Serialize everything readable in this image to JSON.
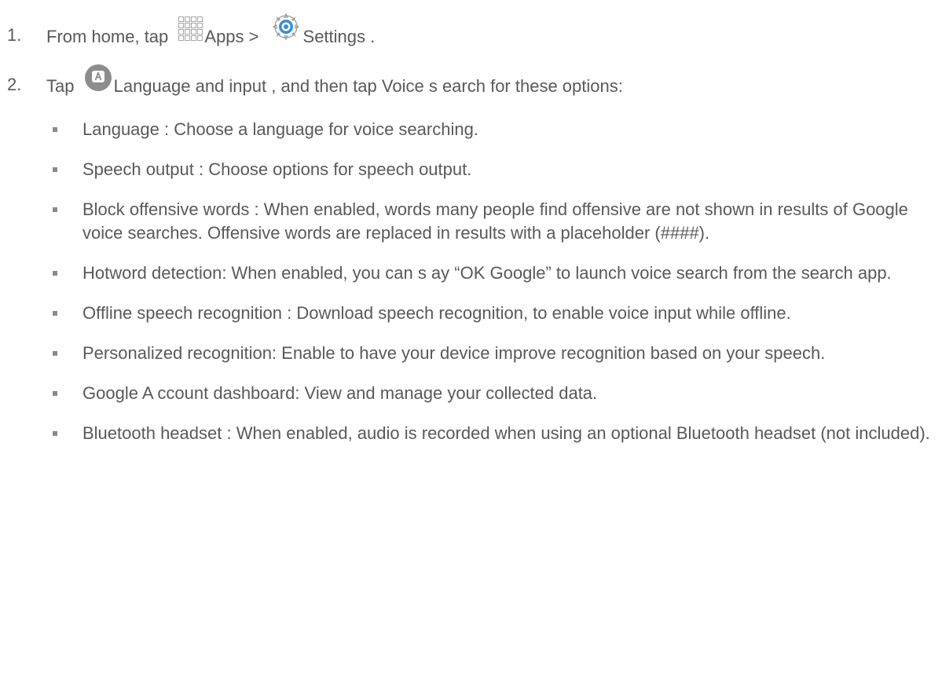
{
  "steps": [
    {
      "number": "1.",
      "prefix": "From home, tap ",
      "apps_label": "Apps",
      "separator": " >",
      "settings_label": "Settings .",
      "apps_icon": "apps-grid-icon",
      "settings_icon": "settings-gear-icon"
    },
    {
      "number": "2.",
      "prefix": "Tap ",
      "suffix": "Language and input   , and then tap Voice s earch  for these options:",
      "icon": "language-input-icon"
    }
  ],
  "options": [
    "Language : Choose a language for voice searching.",
    "Speech output  : Choose options for speech output.",
    "Block offensive words    : When enabled, words many people find offensive are not shown in results of Google voice searches. Offensive words are replaced in results with a placeholder (####).",
    "Hotword detection: When enabled, you can s   ay “OK Google” to launch voice search from the search app.",
    "Offline speech recognition    : Download speech recognition, to enable voice input while offline.",
    "Personalized recognition: Enable to have your device improve recognition based on your speech.",
    "Google A ccount dashboard: View and manage your collected data.",
    "Bluetooth headset   : When enabled, audio is recorded when using an optional Bluetooth headset (not included)."
  ],
  "colors": {
    "text": "#595959",
    "bullet": "#8a8a8a",
    "lang_icon_bg": "#8d8d8d",
    "settings_icon_blue": "#3a8fd6"
  }
}
